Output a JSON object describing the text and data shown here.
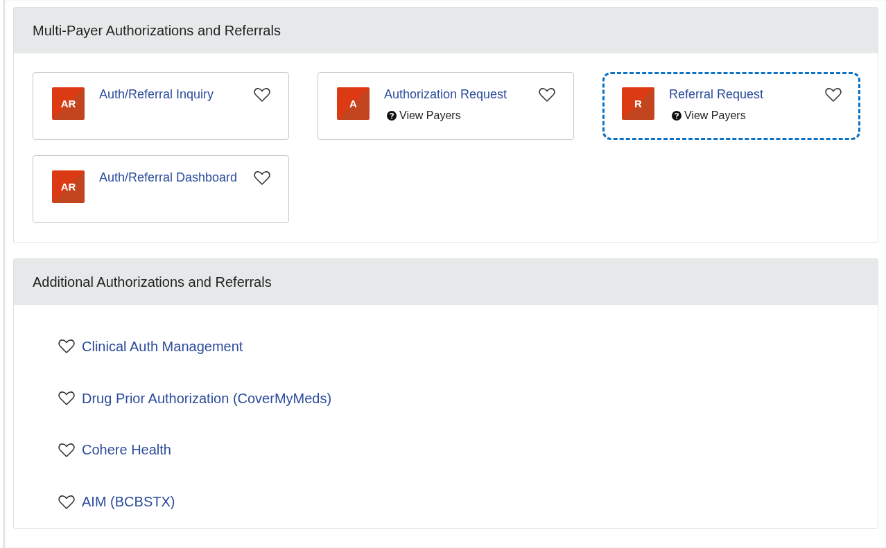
{
  "sections": [
    {
      "title": "Multi-Payer Authorizations and Referrals",
      "kind": "tiles",
      "tiles": [
        {
          "badge": "AR",
          "title": "Auth/Referral Inquiry",
          "favorited": false,
          "focused": false
        },
        {
          "badge": "A",
          "title": "Authorization Request",
          "payers_link": "View Payers",
          "favorited": false,
          "focused": false
        },
        {
          "badge": "R",
          "title": "Referral Request",
          "payers_link": "View Payers",
          "favorited": false,
          "focused": true
        },
        {
          "badge": "AR",
          "title": "Auth/Referral Dashboard",
          "favorited": false,
          "focused": false
        }
      ]
    },
    {
      "title": "Additional Authorizations and Referrals",
      "kind": "links",
      "links": [
        {
          "label": "Clinical Auth Management",
          "favorited": false
        },
        {
          "label": "Drug Prior Authorization (CoverMyMeds)",
          "favorited": false
        },
        {
          "label": "Cohere Health",
          "favorited": false
        },
        {
          "label": "AIM (BCBSTX)",
          "favorited": false
        }
      ]
    }
  ]
}
